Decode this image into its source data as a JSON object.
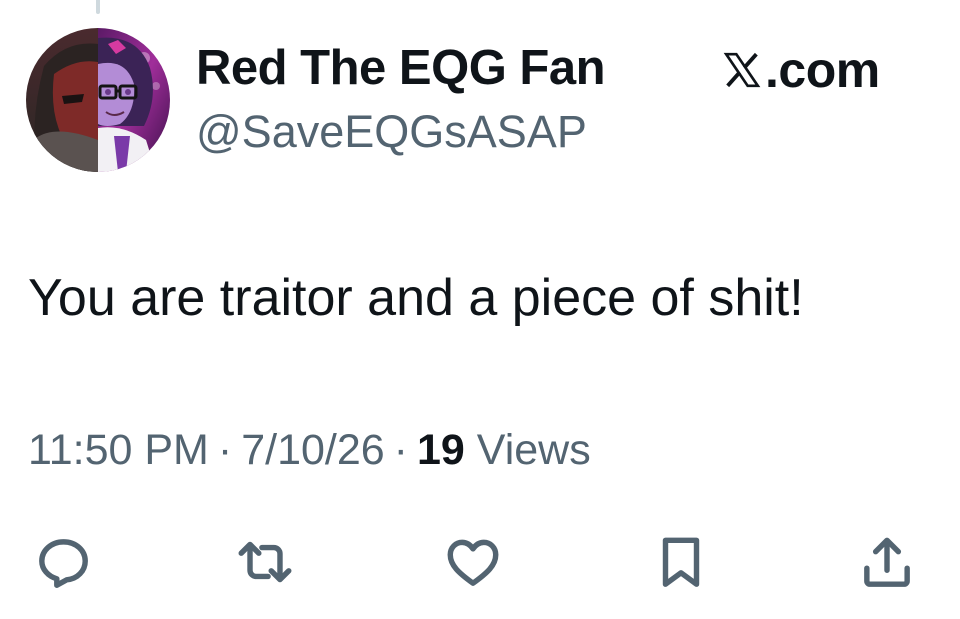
{
  "tweet": {
    "author": {
      "display_name": "Red The EQG Fan",
      "handle": "@SaveEQGsASAP",
      "avatar_icon": "split-character-avatar"
    },
    "brand": {
      "label": ".com",
      "logo_icon": "x-logo-icon"
    },
    "text": "You are traitor and a piece of shit!",
    "meta": {
      "time": "11:50 PM",
      "separator": "·",
      "date": "7/10/26",
      "views_count": "19",
      "views_label": "Views"
    },
    "actions": [
      {
        "name": "reply",
        "icon": "reply-icon"
      },
      {
        "name": "repost",
        "icon": "repost-icon"
      },
      {
        "name": "like",
        "icon": "heart-icon"
      },
      {
        "name": "bookmark",
        "icon": "bookmark-icon"
      },
      {
        "name": "share",
        "icon": "share-icon"
      }
    ],
    "colors": {
      "text_primary": "#0f1419",
      "text_secondary": "#536471",
      "background": "#ffffff"
    }
  }
}
